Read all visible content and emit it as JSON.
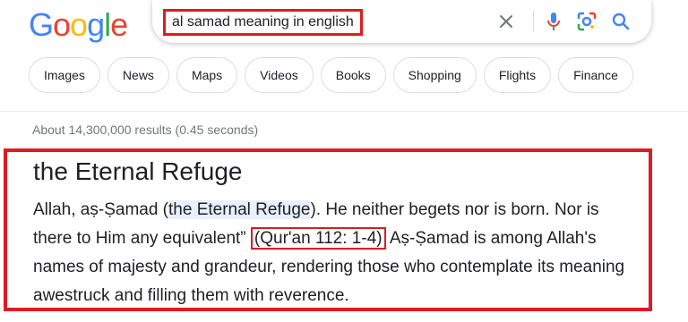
{
  "logo": {
    "letters": [
      "G",
      "o",
      "o",
      "g",
      "l",
      "e"
    ],
    "colors": [
      "#4285f4",
      "#ea4335",
      "#fbbc05",
      "#4285f4",
      "#34a853",
      "#ea4335"
    ]
  },
  "search": {
    "query": "al samad meaning in english",
    "icons": {
      "clear": "close-icon",
      "voice": "microphone-icon",
      "lens": "camera-lens-icon",
      "search": "search-icon"
    }
  },
  "filters": [
    "Images",
    "News",
    "Maps",
    "Videos",
    "Books",
    "Shopping",
    "Flights",
    "Finance"
  ],
  "results": {
    "stats": "About 14,300,000 results (0.45 seconds)"
  },
  "answer": {
    "title": "the Eternal Refuge",
    "text_pre": "Allah, aṣ-Ṣamad (",
    "highlight": "the Eternal Refuge",
    "text_mid": "). He neither begets nor is born. Nor is there to Him any equivalent” ",
    "citation": "(Qur'an 112: 1-4)",
    "text_post": " Aṣ-Ṣamad is among Allah's names of majesty and grandeur, rendering those who contemplate its meaning awestruck and filling them with reverence."
  },
  "colors": {
    "annotation_red": "#e01a22",
    "highlight": "#e8f0fe"
  }
}
